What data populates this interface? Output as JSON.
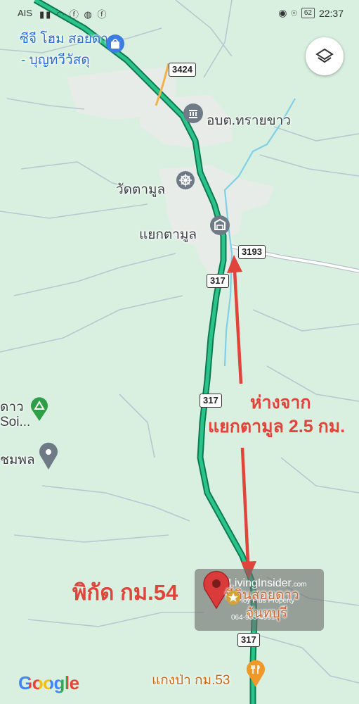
{
  "status_bar": {
    "carrier": "AIS",
    "icons": [
      "signal-icon",
      "wifi-icon",
      "facebook-icon",
      "messenger-icon",
      "facebook-icon"
    ],
    "battery": "62",
    "time": "22:37"
  },
  "places": {
    "store_line1": "ซีจี โฮม สอยดาว",
    "store_line2": "- บุญทวีวัสดุ",
    "sub_district_office": "อบต.ทรายขาว",
    "temple": "วัดตามูล",
    "junction": "แยกตามูล",
    "park_line1": "ดาว",
    "park_line2": "Soi...",
    "place_left": "ชมพล",
    "restaurant": "แกงป่า กม.53"
  },
  "routes": [
    "3424",
    "3193",
    "317",
    "317",
    "317"
  ],
  "annotations": {
    "distance_line1": "ห่างจาก",
    "distance_line2": "แยกตามูล 2.5 กม.",
    "location_label": "พิกัด กม.54"
  },
  "pin": {
    "label_line1": "ที่ดินสอยดาว",
    "label_line2": "จันทบุรี"
  },
  "watermark": {
    "brand": "LivingInsider",
    "domain": ".com",
    "sub": "Ploy Plus Property",
    "phone": "064-935-4991"
  },
  "logo": "Google",
  "colors": {
    "map_bg": "#d9f0e0",
    "highway": "#1aa372",
    "arrow": "#e0443a"
  }
}
